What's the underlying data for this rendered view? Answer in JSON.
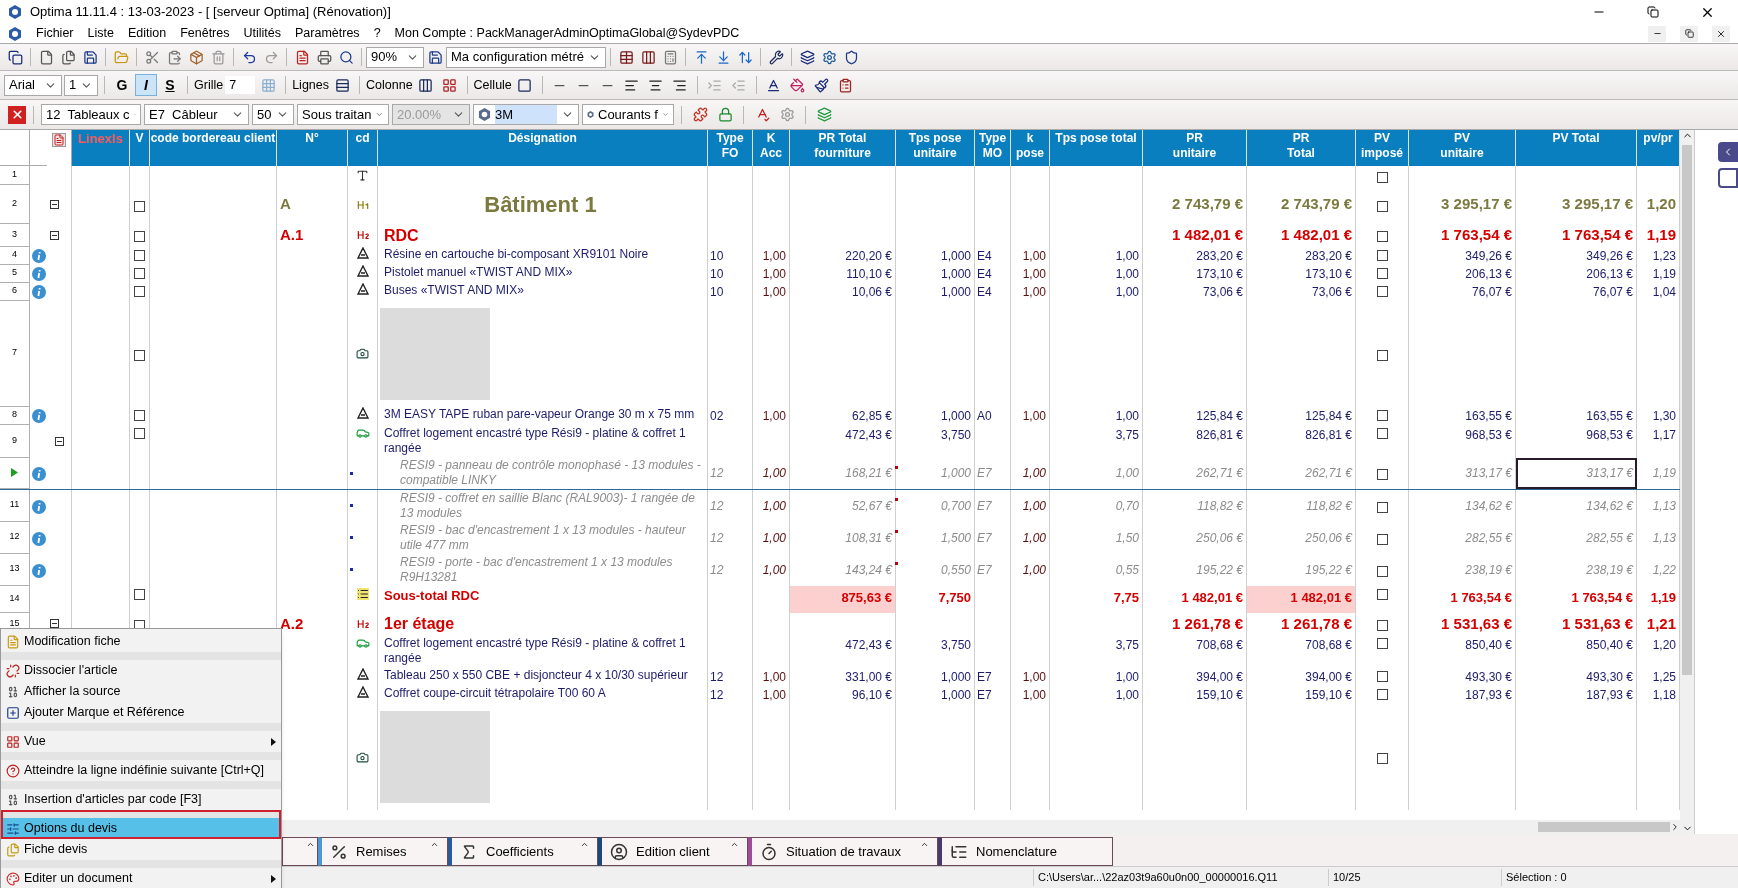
{
  "window": {
    "title": "Optima 11.11.4 : 13-03-2023 - [ [serveur Optima] (Rénovation)]"
  },
  "menu": {
    "items": [
      "Fichier",
      "Liste",
      "Edition",
      "Fenêtres",
      "Utilités",
      "Paramètres",
      "?"
    ],
    "account": "Mon Compte : PackManagerAdminOptimaGlobal@SydevPDC"
  },
  "toolbar1": {
    "zoom": "90%",
    "configuration": "Ma configuration métré"
  },
  "toolbar2": {
    "font": "Arial",
    "size": "1",
    "styles": [
      {
        "label": "G",
        "pressed": false
      },
      {
        "label": "I",
        "pressed": true
      },
      {
        "label": "S",
        "pressed": false
      }
    ],
    "grille_label": "Grille",
    "grille_value": "7",
    "lignes_label": "Lignes",
    "colonne_label": "Colonne",
    "cellule_label": "Cellule"
  },
  "toolbar3": {
    "selects": [
      {
        "value": "12  Tableaux c",
        "disabled": false,
        "logo": false
      },
      {
        "value": "E7  Câbleur",
        "disabled": false,
        "logo": false
      },
      {
        "value": "50",
        "disabled": false,
        "logo": false
      },
      {
        "value": "Sous traitan",
        "disabled": false,
        "logo": false
      },
      {
        "value": "20.00%",
        "disabled": true,
        "logo": false
      },
      {
        "value": "3M",
        "disabled": false,
        "logo": true
      },
      {
        "value": "Courants f",
        "disabled": false,
        "logo": true
      }
    ]
  },
  "table": {
    "columns": [
      {
        "label": "Linexls"
      },
      {
        "label": "V"
      },
      {
        "label": "code bordereau client"
      },
      {
        "label": "N°"
      },
      {
        "label": "cd"
      },
      {
        "label": "Désignation"
      },
      {
        "label": "Type\nFO"
      },
      {
        "label": "K\nAcc"
      },
      {
        "label": "PR Total\nfourniture"
      },
      {
        "label": "Tps pose\nunitaire"
      },
      {
        "label": "Type\nMO"
      },
      {
        "label": "k\npose"
      },
      {
        "label": "Tps pose total"
      },
      {
        "label": "PR\nunitaire"
      },
      {
        "label": "PR\nTotal"
      },
      {
        "label": "PV\nimposé"
      },
      {
        "label": "PV\nunitaire"
      },
      {
        "label": "PV Total"
      },
      {
        "label": "pv/pr"
      }
    ],
    "rows": [
      {
        "num": "1",
        "kind": "text",
        "pv_box": {
          "checked": false
        }
      },
      {
        "num": "2",
        "kind": "title",
        "expanded": true,
        "v_box": {
          "checked": false
        },
        "n": "A",
        "designation": "Bâtiment 1",
        "pr_u": "2 743,79 €",
        "pr_t": "2 743,79 €",
        "pv_box": {
          "checked": false
        },
        "pv_u": "3 295,17 €",
        "pv_t": "3 295,17 €",
        "pv_pr": "1,20"
      },
      {
        "num": "3",
        "kind": "section",
        "expanded": true,
        "v_box": {
          "checked": false
        },
        "n": "A.1",
        "designation": "RDC",
        "pr_u": "1 482,01 €",
        "pr_t": "1 482,01 €",
        "pv_box": {
          "checked": false
        },
        "pv_u": "1 763,54 €",
        "pv_t": "1 763,54 €",
        "pv_pr": "1,19"
      },
      {
        "num": "4",
        "kind": "item",
        "info": true,
        "v_box": {
          "checked": false
        },
        "designation": "Résine en cartouche bi-composant XR9101 Noire",
        "fo": "10",
        "k_acc": "1,00",
        "pr_f": "220,20 €",
        "tps_u": "1,000",
        "mo": "E4",
        "k_pose": "1,00",
        "tps_t": "1,00",
        "pr_u": "283,20 €",
        "pr_t": "283,20 €",
        "pv_box": {
          "checked": false
        },
        "pv_u": "349,26 €",
        "pv_t": "349,26 €",
        "pv_pr": "1,23"
      },
      {
        "num": "5",
        "kind": "item",
        "info": true,
        "v_box": {
          "checked": false
        },
        "designation": "Pistolet manuel «TWIST AND MIX»",
        "fo": "10",
        "k_acc": "1,00",
        "pr_f": "110,10 €",
        "tps_u": "1,000",
        "mo": "E4",
        "k_pose": "1,00",
        "tps_t": "1,00",
        "pr_u": "173,10 €",
        "pr_t": "173,10 €",
        "pv_box": {
          "checked": false
        },
        "pv_u": "206,13 €",
        "pv_t": "206,13 €",
        "pv_pr": "1,19"
      },
      {
        "num": "6",
        "kind": "item",
        "info": true,
        "v_box": {
          "checked": false
        },
        "designation": "Buses «TWIST AND MIX»",
        "fo": "10",
        "k_acc": "1,00",
        "pr_f": "10,06 €",
        "tps_u": "1,000",
        "mo": "E4",
        "k_pose": "1,00",
        "tps_t": "1,00",
        "pr_u": "73,06 €",
        "pr_t": "73,06 €",
        "pv_box": {
          "checked": false
        },
        "pv_u": "76,07 €",
        "pv_t": "76,07 €",
        "pv_pr": "1,04"
      },
      {
        "num": "7",
        "kind": "photo",
        "v_box": {
          "checked": false
        },
        "pv_box": {
          "checked": false
        }
      },
      {
        "num": "8",
        "kind": "item",
        "info": true,
        "v_box": {
          "checked": false
        },
        "designation": "3M EASY TAPE ruban pare-vapeur Orange 30 m x 75 mm",
        "fo": "02",
        "k_acc": "1,00",
        "pr_f": "62,85 €",
        "tps_u": "1,000",
        "mo": "A0",
        "k_pose": "1,00",
        "tps_t": "1,00",
        "pr_u": "125,84 €",
        "pr_t": "125,84 €",
        "pv_box": {
          "checked": false
        },
        "pv_u": "163,55 €",
        "pv_t": "163,55 €",
        "pv_pr": "1,30"
      },
      {
        "num": "9",
        "kind": "kit",
        "expanded": true,
        "v_box": {
          "checked": false
        },
        "designation": "Coffret logement encastré type Rési9 - platine & coffret 1 rangée",
        "pr_f": "472,43 €",
        "tps_u": "3,750",
        "tps_t": "3,75",
        "pr_u": "826,81 €",
        "pr_t": "826,81 €",
        "pv_box": {
          "checked": false
        },
        "pv_u": "968,53 €",
        "pv_t": "968,53 €",
        "pv_pr": "1,17"
      },
      {
        "kind": "sub",
        "current": true,
        "focused": true,
        "info": true,
        "designation": "RESI9 - panneau de contrôle monophasé - 13 modules - compatible LINKY",
        "fo": "12",
        "k_acc": "1,00",
        "pr_f": "168,21 €",
        "tps_u": "1,000",
        "mo": "E7",
        "k_pose": "1,00",
        "tps_t": "1,00",
        "pr_u": "262,71 €",
        "pr_t": "262,71 €",
        "pv_box": {
          "checked": false
        },
        "pv_u": "313,17 €",
        "pv_t": "313,17 €",
        "pv_pr": "1,19"
      },
      {
        "num": "11",
        "kind": "sub",
        "info": true,
        "designation": "RESI9 - coffret en saillie Blanc (RAL9003)- 1 rangée de 13 modules",
        "fo": "12",
        "k_acc": "1,00",
        "pr_f": "52,67 €",
        "tps_u": "0,700",
        "mo": "E7",
        "k_pose": "1,00",
        "tps_t": "0,70",
        "pr_u": "118,82 €",
        "pr_t": "118,82 €",
        "pv_box": {
          "checked": false
        },
        "pv_u": "134,62 €",
        "pv_t": "134,62 €",
        "pv_pr": "1,13"
      },
      {
        "num": "12",
        "kind": "sub",
        "info": true,
        "designation": "RESI9 - bac d'encastrement 1 x 13 modules - hauteur utile 477 mm",
        "fo": "12",
        "k_acc": "1,00",
        "pr_f": "108,31 €",
        "tps_u": "1,500",
        "mo": "E7",
        "k_pose": "1,00",
        "tps_t": "1,50",
        "pr_u": "250,06 €",
        "pr_t": "250,06 €",
        "pv_box": {
          "checked": false
        },
        "pv_u": "282,55 €",
        "pv_t": "282,55 €",
        "pv_pr": "1,13"
      },
      {
        "num": "13",
        "kind": "sub",
        "info": true,
        "designation": "RESI9 - porte - bac d'encastrement 1 x 13 modules R9H13281",
        "fo": "12",
        "k_acc": "1,00",
        "pr_f": "143,24 €",
        "tps_u": "0,550",
        "mo": "E7",
        "k_pose": "1,00",
        "tps_t": "0,55",
        "pr_u": "195,22 €",
        "pr_t": "195,22 €",
        "pv_box": {
          "checked": false
        },
        "pv_u": "238,19 €",
        "pv_t": "238,19 €",
        "pv_pr": "1,22"
      },
      {
        "num": "14",
        "kind": "subtotal",
        "v_box": {
          "checked": false
        },
        "designation": "Sous-total RDC",
        "pr_f": "875,63 €",
        "tps_u": "7,750",
        "tps_t": "7,75",
        "pr_u": "1 482,01 €",
        "pr_t": "1 482,01 €",
        "pv_box": {
          "checked": false
        },
        "pv_u": "1 763,54 €",
        "pv_t": "1 763,54 €",
        "pv_pr": "1,19"
      },
      {
        "num": "15",
        "kind": "section",
        "expanded": true,
        "v_box": {
          "checked": false
        },
        "n": "A.2",
        "designation": "1er étage",
        "pr_u": "1 261,78 €",
        "pr_t": "1 261,78 €",
        "pv_box": {
          "checked": false
        },
        "pv_u": "1 531,63 €",
        "pv_t": "1 531,63 €",
        "pv_pr": "1,21"
      },
      {
        "kind": "kit",
        "designation": "Coffret logement encastré type Rési9 - platine & coffret 1 rangée",
        "pr_f": "472,43 €",
        "tps_u": "3,750",
        "tps_t": "3,75",
        "pr_u": "708,68 €",
        "pr_t": "708,68 €",
        "pv_box": {
          "checked": false
        },
        "pv_u": "850,40 €",
        "pv_t": "850,40 €",
        "pv_pr": "1,20"
      },
      {
        "kind": "item",
        "designation": "Tableau 250 x 550 CBE + disjoncteur 4 x 10/30 supérieur",
        "fo": "12",
        "k_acc": "1,00",
        "pr_f": "331,00 €",
        "tps_u": "1,000",
        "mo": "E7",
        "k_pose": "1,00",
        "tps_t": "1,00",
        "pr_u": "394,00 €",
        "pr_t": "394,00 €",
        "pv_box": {
          "checked": false
        },
        "pv_u": "493,30 €",
        "pv_t": "493,30 €",
        "pv_pr": "1,25"
      },
      {
        "kind": "item",
        "designation": "Coffret coupe-circuit tétrapolaire T00 60 A",
        "fo": "12",
        "k_acc": "1,00",
        "pr_f": "96,10 €",
        "tps_u": "1,000",
        "mo": "E7",
        "k_pose": "1,00",
        "tps_t": "1,00",
        "pr_u": "159,10 €",
        "pr_t": "159,10 €",
        "pv_box": {
          "checked": false
        },
        "pv_u": "187,93 €",
        "pv_t": "187,93 €",
        "pv_pr": "1,18"
      },
      {
        "kind": "photo",
        "pv_box": {
          "checked": false
        }
      }
    ]
  },
  "context_menu": {
    "items": [
      {
        "label": "Modification fiche",
        "separator_before": false,
        "submenu": false,
        "selected": false
      },
      {
        "label": "Dissocier l'article",
        "separator_before": true,
        "submenu": false,
        "selected": false
      },
      {
        "label": "Afficher la source",
        "separator_before": false,
        "submenu": false,
        "selected": false
      },
      {
        "label": "Ajouter Marque et Référence",
        "separator_before": false,
        "submenu": false,
        "selected": false
      },
      {
        "label": "Vue",
        "separator_before": true,
        "submenu": true,
        "selected": false
      },
      {
        "label": "Atteindre la ligne indéfinie suivante [Ctrl+Q]",
        "separator_before": true,
        "submenu": false,
        "selected": false
      },
      {
        "label": "Insertion d'articles par code [F3]",
        "separator_before": true,
        "submenu": false,
        "selected": false
      },
      {
        "label": "Options du devis",
        "separator_before": true,
        "submenu": false,
        "selected": true
      },
      {
        "label": "Fiche devis",
        "separator_before": false,
        "submenu": false,
        "selected": false
      },
      {
        "label": "Editer un document",
        "separator_before": true,
        "submenu": true,
        "selected": false
      }
    ]
  },
  "bottom_tabs": [
    {
      "label": "Remises",
      "caret": true
    },
    {
      "label": "Coefficients",
      "caret": true
    },
    {
      "label": "Edition client",
      "caret": true
    },
    {
      "label": "Situation de travaux",
      "caret": true
    },
    {
      "label": "Nomenclature",
      "caret": false
    }
  ],
  "status_bar": {
    "path": "C:\\Users\\ar...\\22az03t9a60u0n00_00000016.Q11",
    "position": "10/25",
    "selection": "Sélection : 0"
  }
}
